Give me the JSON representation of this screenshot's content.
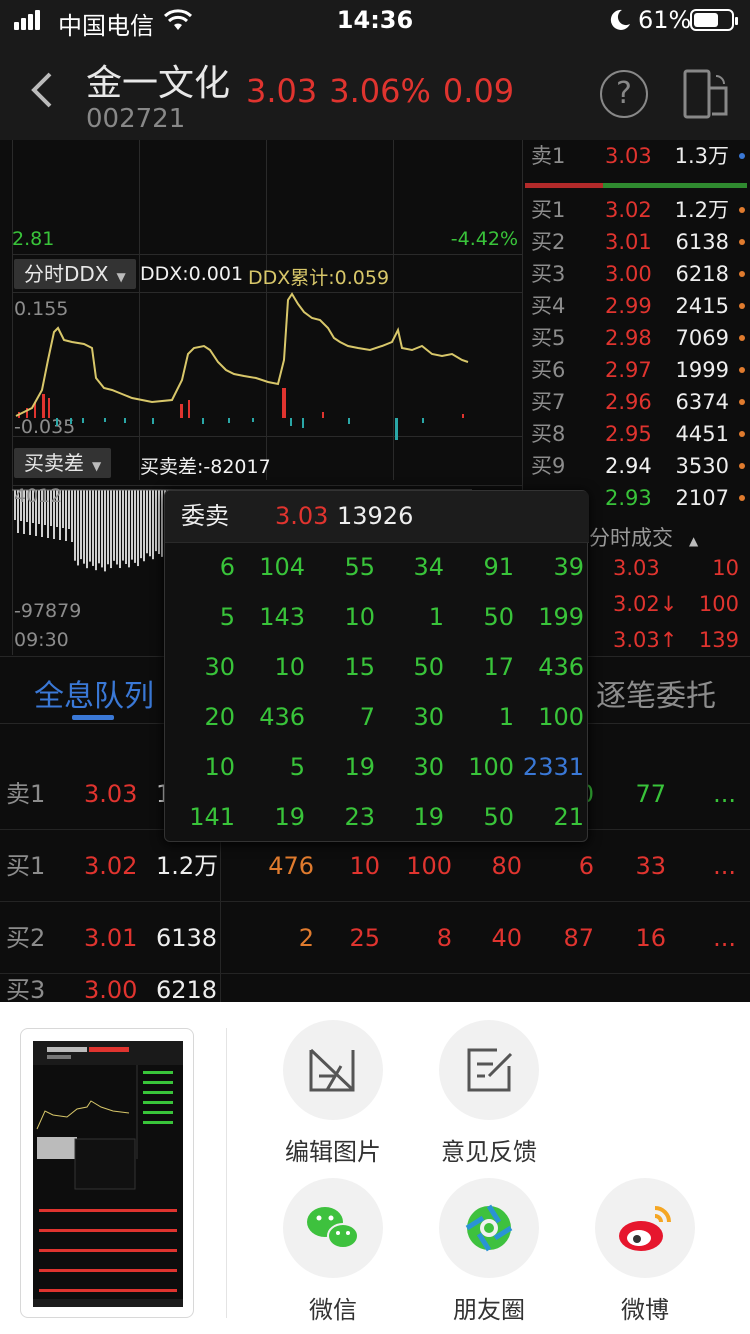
{
  "status_bar": {
    "carrier": "中国电信",
    "time": "14:36",
    "battery": "61%"
  },
  "header": {
    "name": "金一文化",
    "code": "002721",
    "price": "3.03",
    "change_pct": "3.06%",
    "change": "0.09",
    "help_icon": "question-circle-icon",
    "landscape_icon": "rotate-landscape-icon"
  },
  "chart": {
    "low_price_label": "2.81",
    "low_pct_label": "-4.42%",
    "ddx": {
      "selector": "分时DDX",
      "ddx_label": "DDX:0.001",
      "ddx_cum_label": "DDX累计:0.059",
      "top": "0.155",
      "bottom": "-0.035"
    },
    "diff": {
      "selector": "买卖差",
      "label": "买卖差:-82017",
      "top": "4012",
      "bottom": "-97879"
    },
    "time_start": "09:30"
  },
  "orderbook": {
    "sell": [
      {
        "label": "卖1",
        "price": "3.03",
        "vol": "1.3万"
      }
    ],
    "buy": [
      {
        "label": "买1",
        "price": "3.02",
        "vol": "1.2万"
      },
      {
        "label": "买2",
        "price": "3.01",
        "vol": "6138"
      },
      {
        "label": "买3",
        "price": "3.00",
        "vol": "6218"
      },
      {
        "label": "买4",
        "price": "2.99",
        "vol": "2415"
      },
      {
        "label": "买5",
        "price": "2.98",
        "vol": "7069"
      },
      {
        "label": "买6",
        "price": "2.97",
        "vol": "1999"
      },
      {
        "label": "买7",
        "price": "2.96",
        "vol": "6374"
      },
      {
        "label": "买8",
        "price": "2.95",
        "vol": "4451"
      },
      {
        "label": "买9",
        "price": "2.94",
        "vol": "3530"
      },
      {
        "label": "",
        "price": "2.93",
        "vol": "2107"
      }
    ],
    "trades_title": "分时成交",
    "trades": [
      {
        "price": "3.03",
        "vol": "10"
      },
      {
        "price": "3.02↓",
        "vol": "100"
      },
      {
        "price": "3.03↑",
        "vol": "139"
      }
    ]
  },
  "tabs": {
    "full_queue": "全息队列",
    "tick_orders": "逐笔委托"
  },
  "queue": {
    "rows": [
      {
        "label": "卖1",
        "price": "3.03",
        "vol": "1",
        "cells": [
          "",
          "",
          "",
          "",
          "0",
          "77",
          "..."
        ]
      },
      {
        "label": "买1",
        "price": "3.02",
        "vol": "1.2万",
        "cells": [
          "476",
          "10",
          "100",
          "80",
          "6",
          "33",
          "..."
        ]
      },
      {
        "label": "买2",
        "price": "3.01",
        "vol": "6138",
        "cells": [
          "2",
          "25",
          "8",
          "40",
          "87",
          "16",
          "..."
        ]
      }
    ]
  },
  "popup": {
    "title": "委卖",
    "price": "3.03",
    "volume": "13926",
    "grid": [
      [
        "6",
        "104",
        "55",
        "34",
        "91",
        "39"
      ],
      [
        "5",
        "143",
        "10",
        "1",
        "50",
        "199"
      ],
      [
        "30",
        "10",
        "15",
        "50",
        "17",
        "436"
      ],
      [
        "20",
        "436",
        "7",
        "30",
        "1",
        "100"
      ],
      [
        "10",
        "5",
        "19",
        "30",
        "100",
        "2331"
      ],
      [
        "141",
        "19",
        "23",
        "19",
        "50",
        "21"
      ]
    ]
  },
  "share": {
    "edit_image": "编辑图片",
    "feedback": "意见反馈",
    "wechat": "微信",
    "moments": "朋友圈",
    "weibo": "微博"
  },
  "colors": {
    "up": "#e0342f",
    "down": "#39c43a",
    "accent": "#3a78d6",
    "line": "#d8c76a"
  }
}
